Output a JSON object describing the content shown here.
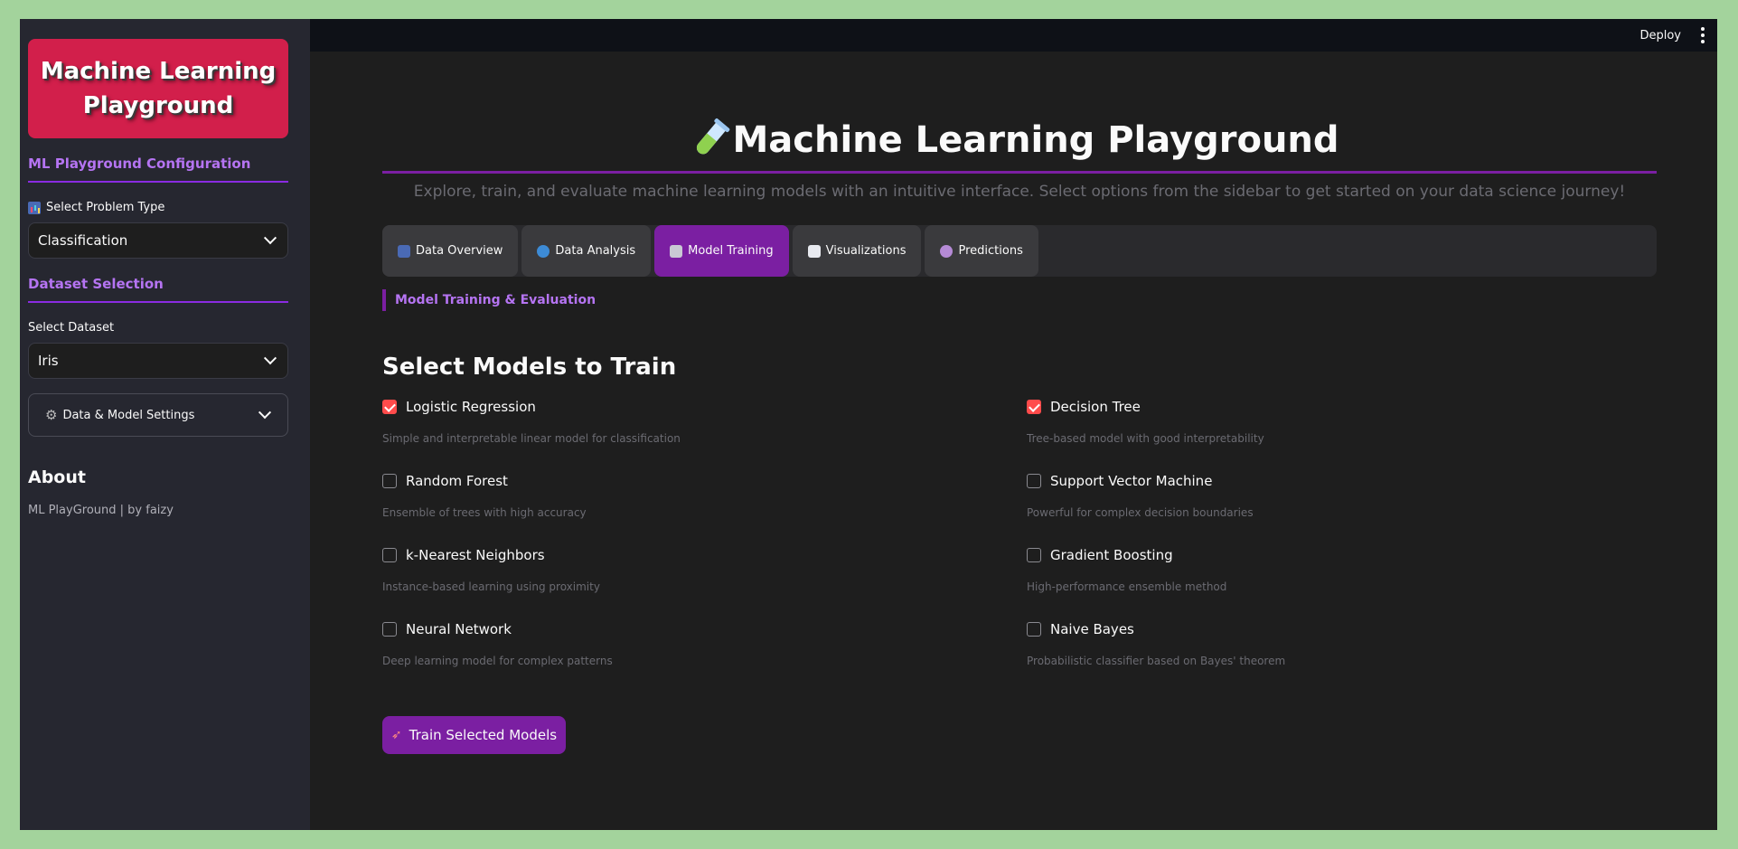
{
  "sidebar": {
    "logo_text": "Machine Learning Playground",
    "config_title": "ML Playground Configuration",
    "problem_type": {
      "label": "Select Problem Type",
      "icon": "bar-chart-icon",
      "value": "Classification"
    },
    "dataset_title": "Dataset Selection",
    "dataset": {
      "label": "Select Dataset",
      "value": "Iris"
    },
    "settings_expander": {
      "icon": "gear-icon",
      "label": "Data & Model Settings"
    },
    "about_title": "About",
    "about_text": "ML PlayGround | by faizy"
  },
  "topbar": {
    "deploy_label": "Deploy",
    "menu_icon": "kebab-menu-icon"
  },
  "hero": {
    "icon": "test-tube-icon",
    "title": "Machine Learning Playground",
    "subtitle": "Explore, train, and evaluate machine learning models with an intuitive interface. Select options from the sidebar to get started on your data science journey!"
  },
  "tabs": [
    {
      "label": "Data Overview",
      "icon": "bar-chart-icon",
      "active": false
    },
    {
      "label": "Data Analysis",
      "icon": "magnifier-icon",
      "active": false
    },
    {
      "label": "Model Training",
      "icon": "robot-icon",
      "active": true
    },
    {
      "label": "Visualizations",
      "icon": "line-chart-icon",
      "active": false
    },
    {
      "label": "Predictions",
      "icon": "crystal-ball-icon",
      "active": false
    }
  ],
  "section_label": "Model Training & Evaluation",
  "models_heading": "Select Models to Train",
  "models": [
    {
      "name": "Logistic Regression",
      "desc": "Simple and interpretable linear model for classification",
      "checked": true
    },
    {
      "name": "Decision Tree",
      "desc": "Tree-based model with good interpretability",
      "checked": true
    },
    {
      "name": "Random Forest",
      "desc": "Ensemble of trees with high accuracy",
      "checked": false
    },
    {
      "name": "Support Vector Machine",
      "desc": "Powerful for complex decision boundaries",
      "checked": false
    },
    {
      "name": "k-Nearest Neighbors",
      "desc": "Instance-based learning using proximity",
      "checked": false
    },
    {
      "name": "Gradient Boosting",
      "desc": "High-performance ensemble method",
      "checked": false
    },
    {
      "name": "Neural Network",
      "desc": "Deep learning model for complex patterns",
      "checked": false
    },
    {
      "name": "Naive Bayes",
      "desc": "Probabilistic classifier based on Bayes' theorem",
      "checked": false
    }
  ],
  "train_button": {
    "icon": "rocket-icon",
    "label": "Train Selected Models"
  },
  "colors": {
    "accent": "#7b1fa2",
    "logo_bg": "#d21f4b",
    "checkbox_checked": "#ff4b4b",
    "sidebar_bg": "#262730"
  }
}
